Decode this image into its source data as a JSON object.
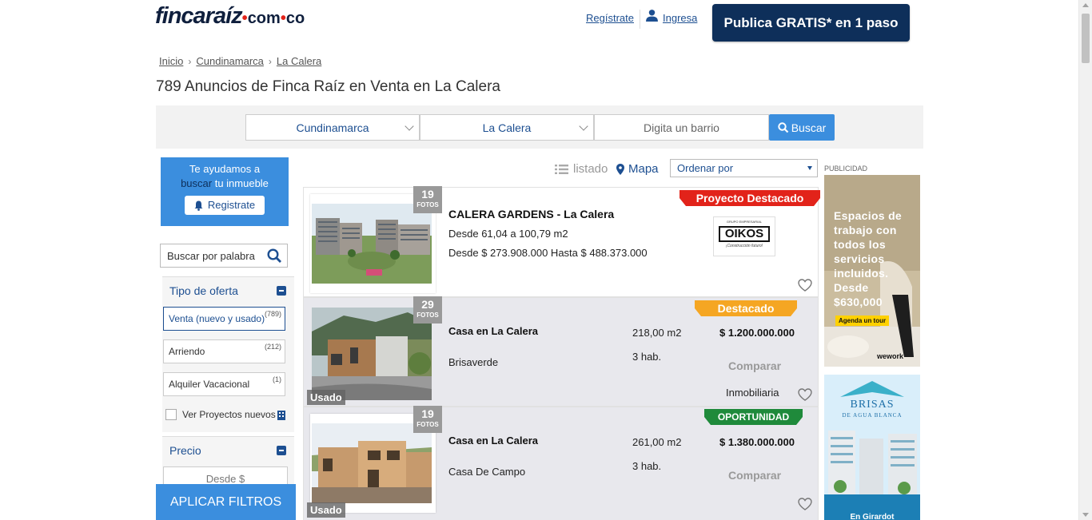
{
  "header": {
    "logo_main": "fincaraíz",
    "logo_domain": "com",
    "logo_tld": "co",
    "register_link": "Regístrate",
    "login_link": "Ingresa",
    "publish_button": "Publica GRATIS* en 1 paso"
  },
  "breadcrumb": [
    "Inicio",
    "Cundinamarca",
    "La Calera"
  ],
  "page_title": "789 Anuncios de Finca Raíz en Venta en La Calera",
  "search": {
    "department": "Cundinamarca",
    "city": "La Calera",
    "barrio_placeholder": "Digita un barrio",
    "button": "Buscar"
  },
  "sidebar": {
    "help_line1": "Te ayudamos a",
    "help_highlight": "buscar",
    "help_line2": " tu inmueble",
    "help_button": "Registrate",
    "word_search_placeholder": "Buscar por palabra",
    "offer_heading": "Tipo de oferta",
    "offers": [
      {
        "label": "Venta (nuevo y usado)",
        "count": "(789)"
      },
      {
        "label": "Arriendo",
        "count": "(212)"
      },
      {
        "label": "Alquiler Vacacional",
        "count": "(1)"
      }
    ],
    "projects_label": "Ver Proyectos nuevos",
    "price_heading": "Precio",
    "price_from_placeholder": "Desde $",
    "apply_button": "APLICAR FILTROS"
  },
  "view": {
    "list_label": "listado",
    "map_label": "Mapa",
    "order_label": "Ordenar por"
  },
  "listings": [
    {
      "photos": "19",
      "photos_label": "FOTOS",
      "ribbon": "Proyecto Destacado",
      "title": "CALERA GARDENS - La Calera",
      "area_range": "Desde 61,04 a 100,79 m2",
      "price_range": "Desde $ 273.908.000 Hasta $ 488.373.000",
      "builder_top": "GRUPO EMPRESARIAL",
      "builder_name": "OIKOS",
      "builder_sub": "¡Construcción futuro!"
    },
    {
      "photos": "29",
      "photos_label": "FOTOS",
      "ribbon": "Destacado",
      "condition": "Usado",
      "title": "Casa en La Calera",
      "neighborhood": "Brisaverde",
      "area": "218,00 m2",
      "rooms": "3 hab.",
      "price": "$ 1.200.000.000",
      "compare": "Comparar",
      "seller": "Inmobiliaria"
    },
    {
      "photos": "19",
      "photos_label": "FOTOS",
      "ribbon": "OPORTUNIDAD",
      "condition": "Usado",
      "title": "Casa en La Calera",
      "neighborhood": "Casa De Campo",
      "area": "261,00 m2",
      "rooms": "3 hab.",
      "price": "$ 1.380.000.000",
      "compare": "Comparar"
    }
  ],
  "ads": {
    "label": "PUBLICIDAD",
    "ad1_text": "Espacios de trabajo con todos los servicios incluidos. Desde $630,000",
    "ad1_cta": "Agenda un tour",
    "ad1_brand": "wework",
    "ad2_title": "BRISAS",
    "ad2_subtitle": "DE AGUA BLANCA",
    "ad2_footer": "En Girardot"
  },
  "colors": {
    "brand_navy": "#0e2f5a",
    "accent_blue": "#3b8ede",
    "link_blue": "#1d4f91",
    "ribbon_red": "#e2231a",
    "ribbon_orange": "#f5a623",
    "ribbon_green": "#1f8a3b"
  }
}
